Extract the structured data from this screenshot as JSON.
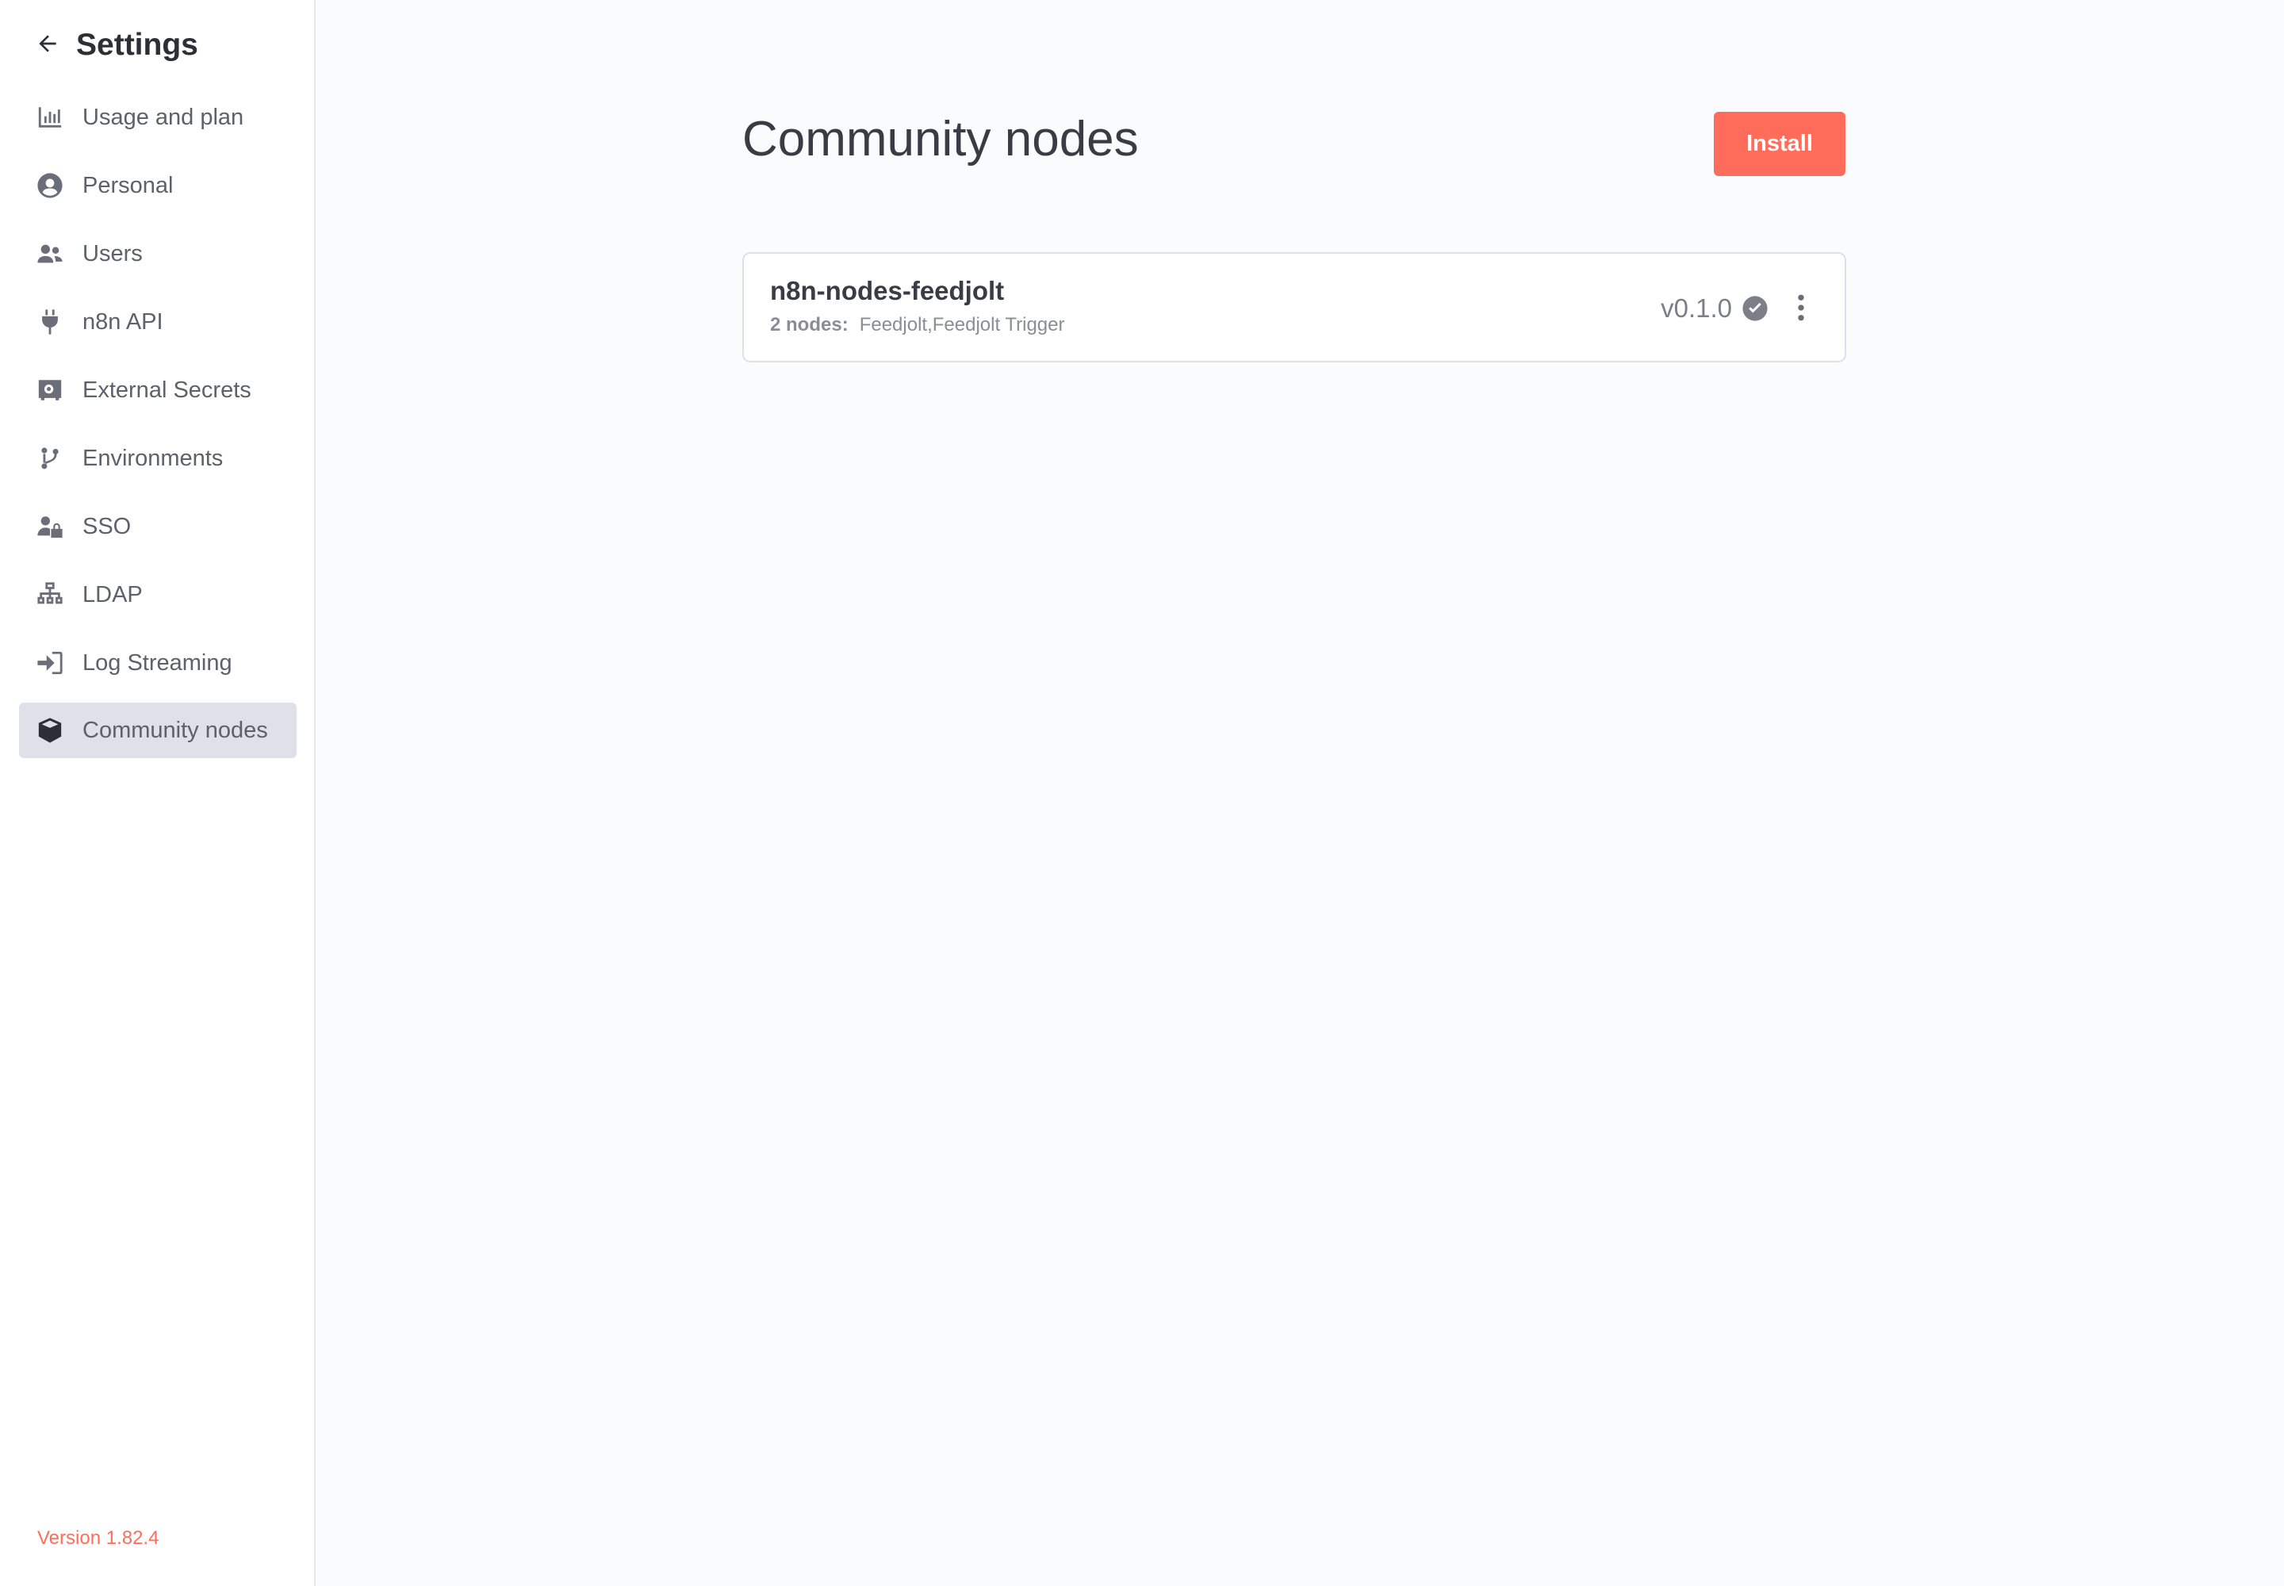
{
  "sidebar": {
    "title": "Settings",
    "back_icon": "arrow-left-icon",
    "items": [
      {
        "label": "Usage and plan",
        "icon": "chart-bar-icon"
      },
      {
        "label": "Personal",
        "icon": "user-circle-icon"
      },
      {
        "label": "Users",
        "icon": "user-friends-icon"
      },
      {
        "label": "n8n API",
        "icon": "plug-icon"
      },
      {
        "label": "External Secrets",
        "icon": "vault-icon"
      },
      {
        "label": "Environments",
        "icon": "code-branch-icon"
      },
      {
        "label": "SSO",
        "icon": "user-lock-icon"
      },
      {
        "label": "LDAP",
        "icon": "network-wired-icon"
      },
      {
        "label": "Log Streaming",
        "icon": "sign-in-icon"
      },
      {
        "label": "Community nodes",
        "icon": "cube-icon",
        "active": true
      }
    ],
    "version": "Version 1.82.4"
  },
  "main": {
    "title": "Community nodes",
    "install_label": "Install",
    "packages": [
      {
        "name": "n8n-nodes-feedjolt",
        "nodes_count": "2 nodes:",
        "nodes_list": "Feedjolt,Feedjolt Trigger",
        "version": "v0.1.0",
        "verified_icon": "check-circle-icon",
        "menu_icon": "ellipsis-vertical-icon"
      }
    ]
  },
  "colors": {
    "accent": "#ff6d5a",
    "active_bg": "#dfe1e8",
    "background": "#fafbfc"
  }
}
